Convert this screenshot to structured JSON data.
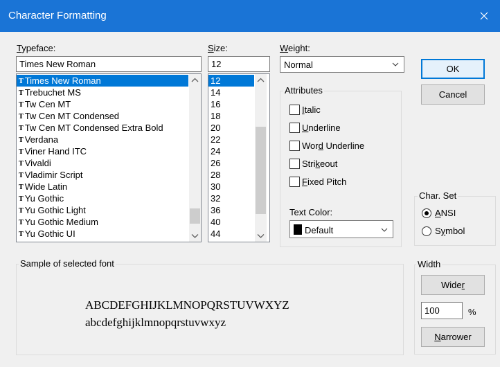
{
  "window": {
    "title": "Character Formatting"
  },
  "typeface": {
    "label_pre": "",
    "label_mnemonic": "T",
    "label_post": "ypeface:",
    "value": "Times New Roman",
    "items": [
      "Times New Roman",
      "Trebuchet MS",
      "Tw Cen MT",
      "Tw Cen MT Condensed",
      "Tw Cen MT Condensed Extra Bold",
      "Verdana",
      "Viner Hand ITC",
      "Vivaldi",
      "Vladimir Script",
      "Wide Latin",
      "Yu Gothic",
      "Yu Gothic Light",
      "Yu Gothic Medium",
      "Yu Gothic UI"
    ],
    "selected_index": 0,
    "truetype_glyph": "T"
  },
  "size": {
    "label_pre": "",
    "label_mnemonic": "S",
    "label_post": "ize:",
    "value": "12",
    "items": [
      "12",
      "14",
      "16",
      "18",
      "20",
      "22",
      "24",
      "26",
      "28",
      "30",
      "32",
      "36",
      "40",
      "44"
    ],
    "selected_index": 0
  },
  "weight": {
    "label_pre": "",
    "label_mnemonic": "W",
    "label_post": "eight:",
    "value": "Normal"
  },
  "attributes": {
    "label": "Attributes",
    "items": [
      {
        "pre": "",
        "mn": "I",
        "post": "talic",
        "checked": false
      },
      {
        "pre": "",
        "mn": "U",
        "post": "nderline",
        "checked": false
      },
      {
        "pre": "Wor",
        "mn": "d",
        "post": " Underline",
        "checked": false
      },
      {
        "pre": "Stri",
        "mn": "k",
        "post": "eout",
        "checked": false
      },
      {
        "pre": "",
        "mn": "F",
        "post": "ixed Pitch",
        "checked": false
      }
    ]
  },
  "text_color": {
    "label": "Text Color:",
    "value": "Default",
    "swatch": "#000000"
  },
  "buttons": {
    "ok": "OK",
    "cancel": "Cancel",
    "wider_pre": "Wide",
    "wider_mn": "r",
    "wider_post": "",
    "narrower_pre": "",
    "narrower_mn": "N",
    "narrower_post": "arrower"
  },
  "charset": {
    "label": "Char. Set",
    "options": [
      {
        "pre": "",
        "mn": "A",
        "post": "NSI",
        "selected": true
      },
      {
        "pre": "S",
        "mn": "y",
        "post": "mbol",
        "selected": false
      }
    ]
  },
  "sample": {
    "label": "Sample of selected font",
    "upper": "ABCDEFGHIJKLMNOPQRSTUVWXYZ",
    "lower": "abcdefghijklmnopqrstuvwxyz"
  },
  "width": {
    "label": "Width",
    "value": "100",
    "unit": "%"
  },
  "colors": {
    "titlebar": "#1a74d6",
    "selection": "#0078d7",
    "dialog_bg": "#f0f0f0"
  }
}
